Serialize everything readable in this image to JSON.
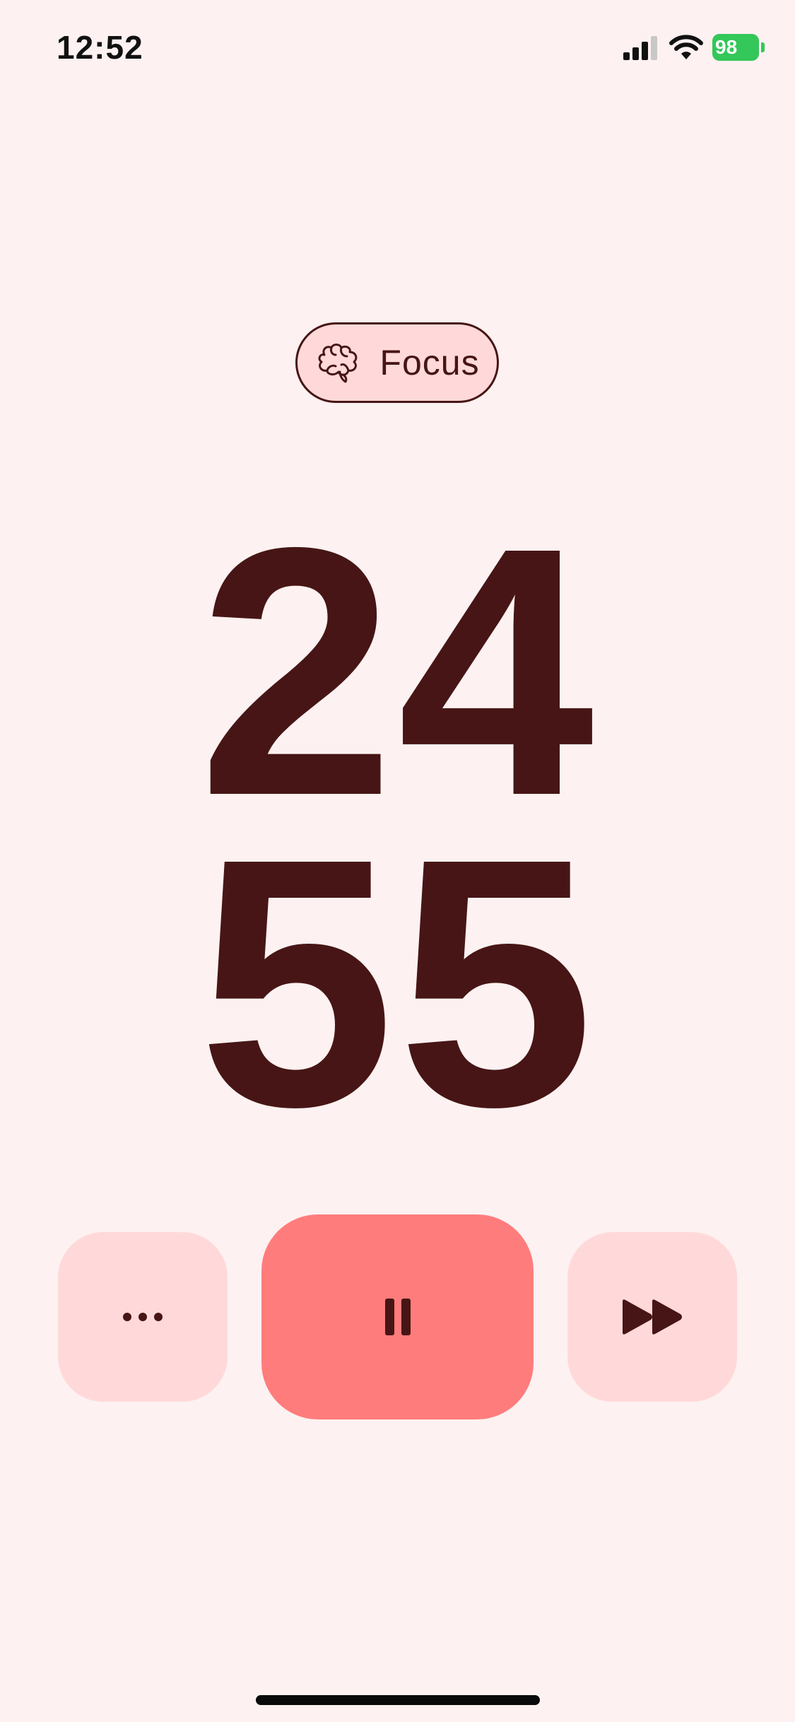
{
  "status_bar": {
    "time": "12:52",
    "battery_percent": "98",
    "battery_color": "#34c759",
    "signal_icon": "cellular-signal-icon",
    "wifi_icon": "wifi-icon"
  },
  "mode": {
    "icon": "brain-icon",
    "label": "Focus"
  },
  "timer": {
    "minutes": "24",
    "seconds": "55"
  },
  "controls": {
    "more_icon": "more-dots-icon",
    "pause_icon": "pause-icon",
    "skip_icon": "skip-forward-icon"
  },
  "colors": {
    "background": "#fdf1f1",
    "text": "#471515",
    "secondary_button": "#ffd9d9",
    "primary_button": "#ff7c7c"
  }
}
